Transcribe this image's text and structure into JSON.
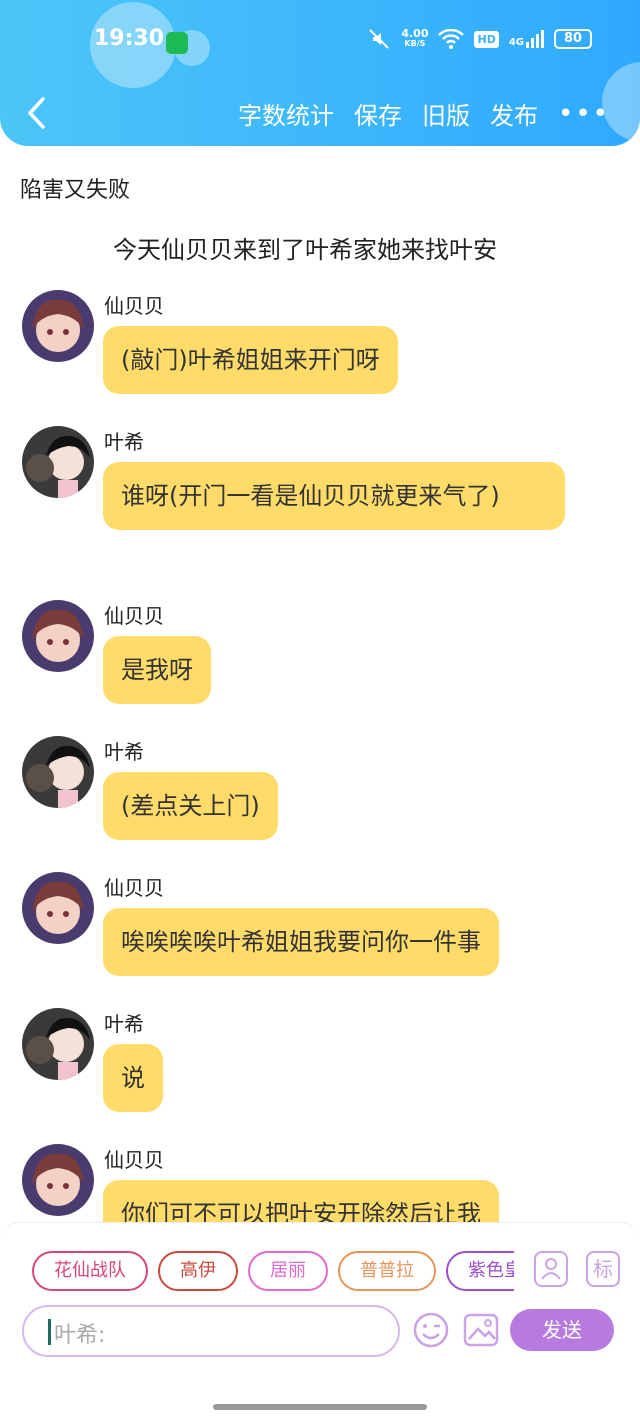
{
  "status_bar": {
    "time": "19:30",
    "net_speed": "4.00",
    "net_unit": "KB/S",
    "hd": "HD",
    "signal": "4G",
    "battery": "80"
  },
  "toolbar": {
    "word_count": "字数统计",
    "save": "保存",
    "old_version": "旧版",
    "publish": "发布",
    "more": "•••"
  },
  "story": {
    "title": "陷害又失败",
    "intro": "今天仙贝贝来到了叶希家她来找叶安"
  },
  "messages": [
    {
      "speaker": "仙贝贝",
      "text": "(敲门)叶希姐姐来开门呀"
    },
    {
      "speaker": "叶希",
      "text": "谁呀(开门一看是仙贝贝就更来气了)"
    },
    {
      "speaker": "仙贝贝",
      "text": "是我呀"
    },
    {
      "speaker": "叶希",
      "text": "(差点关上门)"
    },
    {
      "speaker": "仙贝贝",
      "text": "唉唉唉唉叶希姐姐我要问你一件事"
    },
    {
      "speaker": "叶希",
      "text": "说"
    },
    {
      "speaker": "仙贝贝",
      "text": "你们可不可以把叶安开除然后让我"
    }
  ],
  "characters": [
    "花仙战队",
    "高伊",
    "居丽",
    "普普拉",
    "紫色皇"
  ],
  "character_colors": [
    "#d6467a",
    "#c94a3f",
    "#e06ad0",
    "#e8955a",
    "#9b52c9"
  ],
  "side_buttons": {
    "role_icon": "person-card-icon",
    "tag": "标"
  },
  "input": {
    "placeholder": "叶希:"
  },
  "send_label": "发送"
}
